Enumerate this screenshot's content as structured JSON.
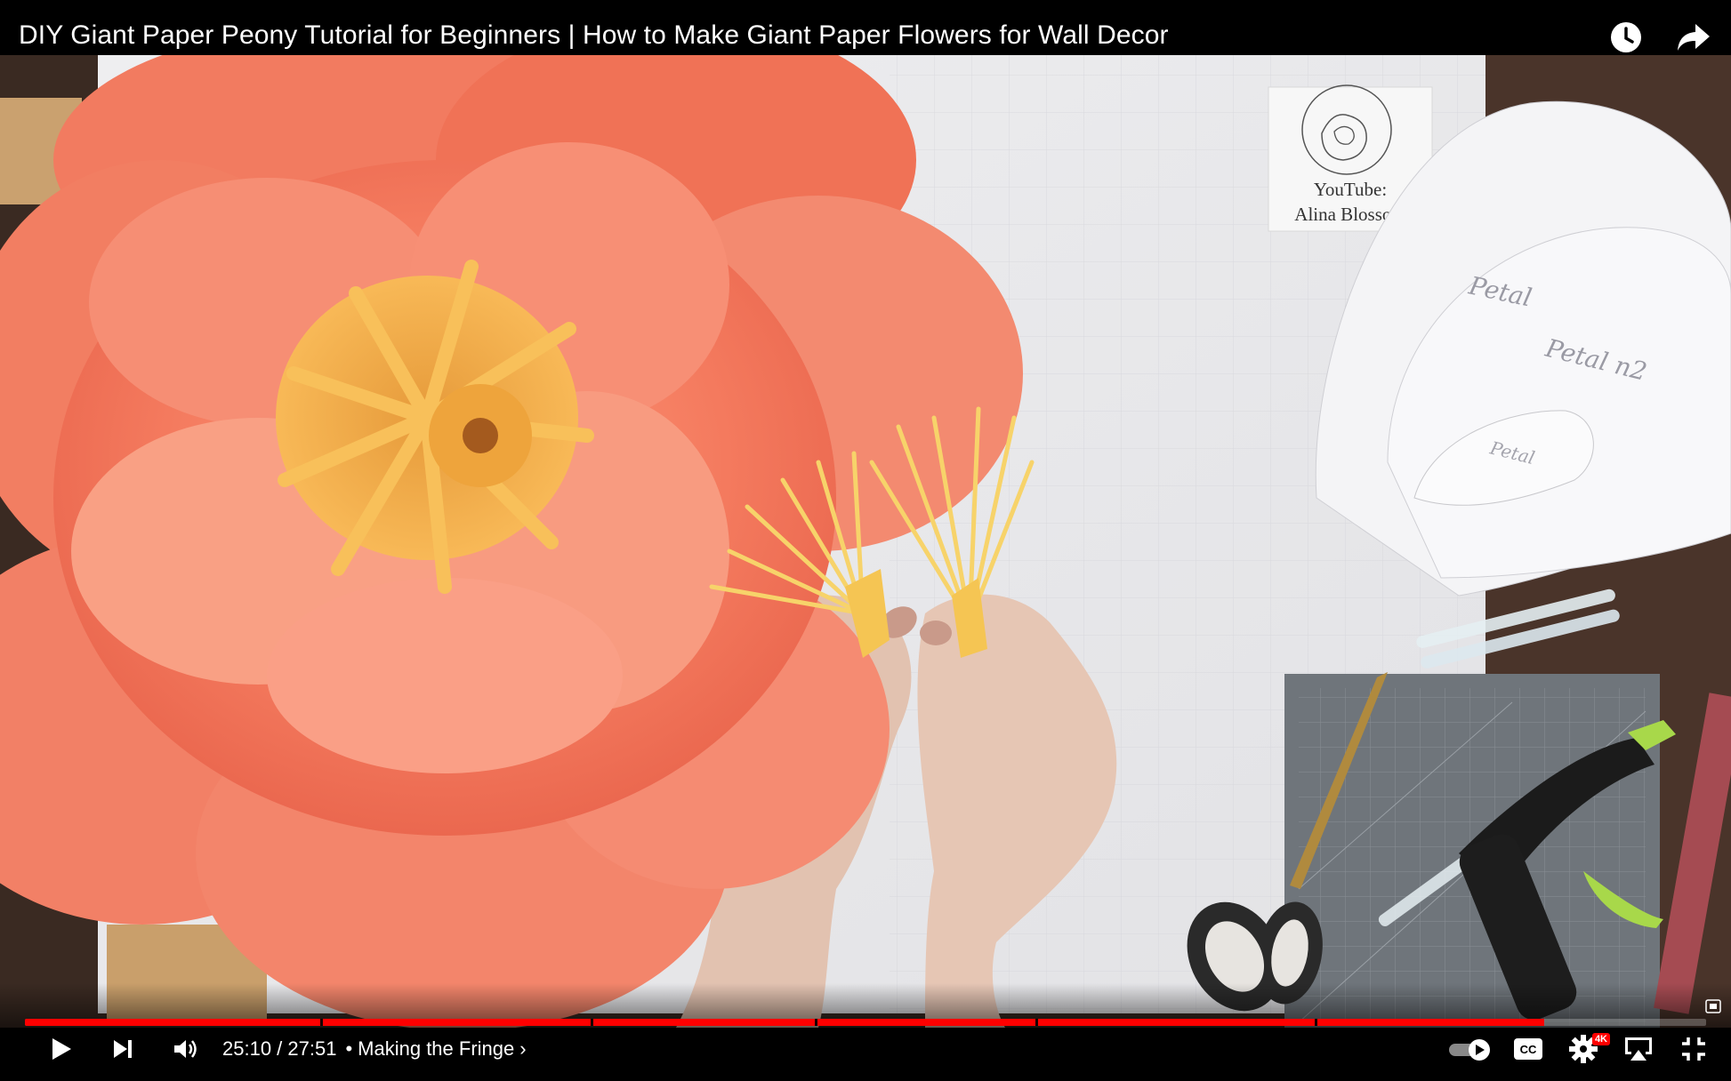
{
  "video": {
    "title": "DIY Giant Paper Peony Tutorial for Beginners | How to Make Giant Paper Flowers for Wall Decor",
    "watermark_line1": "YouTube:",
    "watermark_line2": "Alina Blossom",
    "template_labels": [
      "Petal",
      "Petal n2",
      "Petal"
    ]
  },
  "top_icons": [
    "watch-later-icon",
    "share-icon"
  ],
  "player": {
    "current_time": "25:10",
    "duration": "27:51",
    "time_display": "25:10 / 27:51",
    "chapter_separator": "•",
    "chapter_title": "Making the Fringe",
    "chapter_chevron": "›",
    "progress_fraction": 0.9037,
    "quality_badge": "4K"
  },
  "controls": {
    "left": [
      "play-icon",
      "next-icon",
      "volume-icon"
    ],
    "right": [
      "autoplay-toggle",
      "captions-icon",
      "settings-icon",
      "airplay-icon",
      "exit-fullscreen-icon"
    ],
    "captions_label": "CC"
  },
  "colors": {
    "progress": "#ff0000",
    "petal": "#f57a62",
    "stamen": "#f6b94a",
    "background": "#000000"
  }
}
